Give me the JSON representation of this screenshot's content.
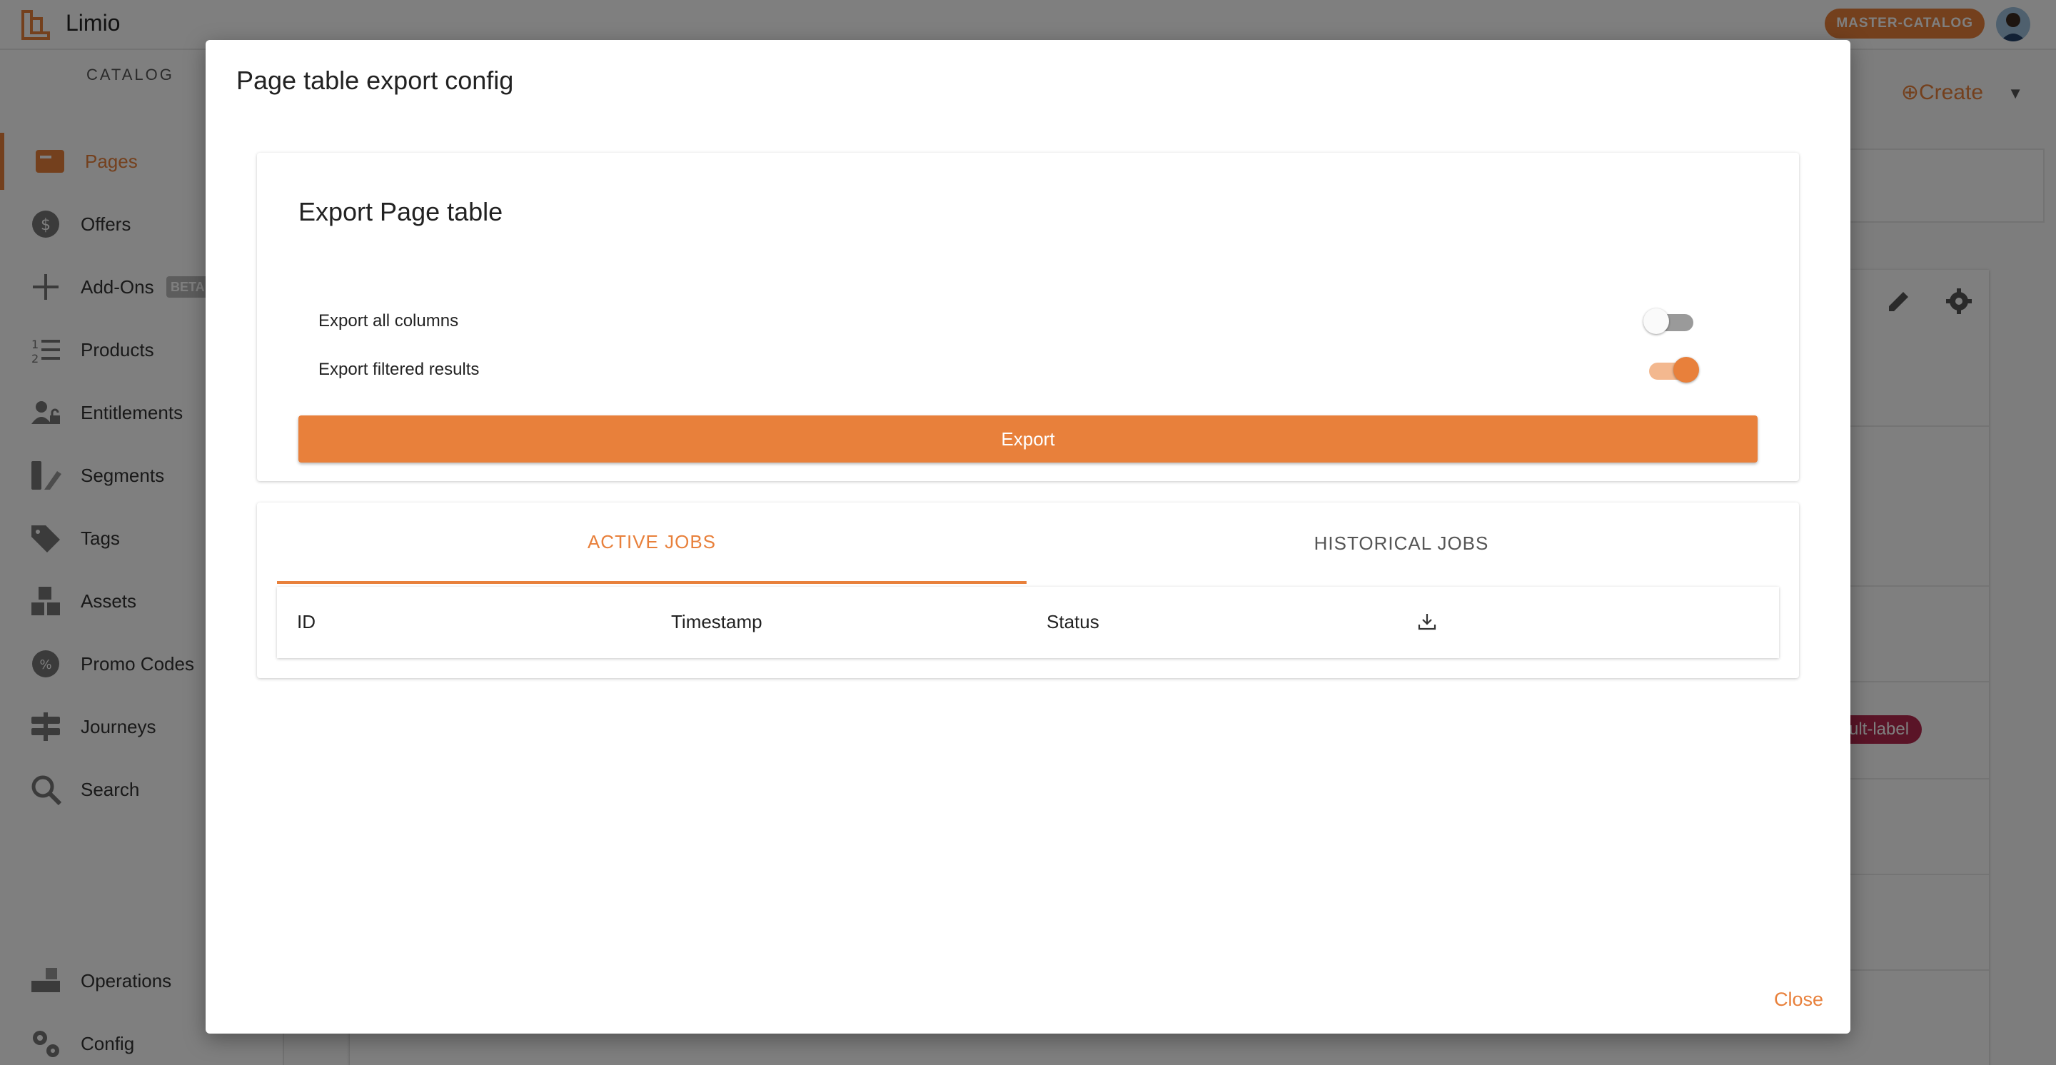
{
  "app": {
    "brand": "Limio",
    "environment": "MASTER-CATALOG"
  },
  "sidebar": {
    "section_title": "CATALOG",
    "items": [
      {
        "label": "Pages",
        "icon": "pages-icon",
        "active": true
      },
      {
        "label": "Offers",
        "icon": "offers-icon"
      },
      {
        "label": "Add-Ons",
        "icon": "add-ons-icon",
        "badge": "BETA"
      },
      {
        "label": "Products",
        "icon": "products-icon"
      },
      {
        "label": "Entitlements",
        "icon": "entitlements-icon"
      },
      {
        "label": "Segments",
        "icon": "segments-icon"
      },
      {
        "label": "Tags",
        "icon": "tags-icon"
      },
      {
        "label": "Assets",
        "icon": "assets-icon"
      },
      {
        "label": "Promo Codes",
        "icon": "promo-codes-icon"
      },
      {
        "label": "Journeys",
        "icon": "journeys-icon"
      },
      {
        "label": "Search",
        "icon": "search-icon"
      }
    ],
    "bottom_items": [
      {
        "label": "Operations",
        "icon": "operations-icon"
      },
      {
        "label": "Config",
        "icon": "config-icon"
      }
    ]
  },
  "background": {
    "create_label": "Create",
    "label_chip": "ult-label"
  },
  "modal": {
    "title": "Page table export config",
    "export_section": {
      "title": "Export Page table",
      "options": [
        {
          "label": "Export all columns",
          "enabled": false
        },
        {
          "label": "Export filtered results",
          "enabled": true
        }
      ],
      "export_button": "Export"
    },
    "jobs": {
      "tabs": [
        {
          "label": "ACTIVE JOBS",
          "active": true
        },
        {
          "label": "HISTORICAL JOBS",
          "active": false
        }
      ],
      "columns": [
        "ID",
        "Timestamp",
        "Status"
      ],
      "download_icon": "download-icon",
      "rows": []
    },
    "close_label": "Close"
  },
  "colors": {
    "accent": "#e8803b",
    "overlay": "rgba(0,0,0,0.5)",
    "label_chip": "#b5294f"
  }
}
